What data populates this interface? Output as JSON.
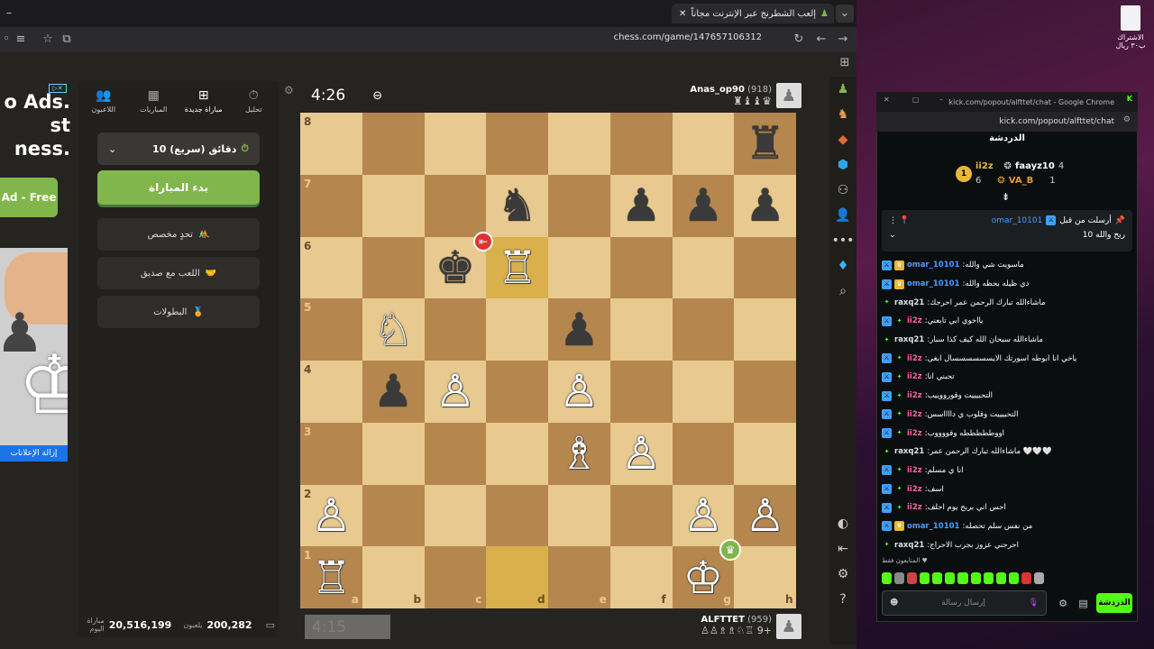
{
  "browser": {
    "tab_title": "إلعب الشطرنج عبر الإنترنت مجاناً",
    "url": "chess.com/game/147657106312"
  },
  "ad": {
    "headline": "o Ads.\nst\nness.",
    "button": "Ad - Free",
    "footer": "إزالة الإعلانات"
  },
  "panel": {
    "tabs": [
      {
        "label": "تحليل",
        "icon": "stopwatch-icon"
      },
      {
        "label": "مباراة جديدة",
        "icon": "plus-icon"
      },
      {
        "label": "المباريات",
        "icon": "board-icon"
      },
      {
        "label": "اللاعبون",
        "icon": "players-icon"
      }
    ],
    "time_control": "10 دقائق (سريع)",
    "start_button": "بدء المباراة",
    "buttons": [
      {
        "label": "تحدٍ مخصص"
      },
      {
        "label": "اللعب مع صديق"
      },
      {
        "label": "البطولات"
      }
    ],
    "stats": {
      "playing_value": "200,282",
      "playing_label": "يلعبون",
      "games_value": "20,516,199",
      "games_label": "مباراة اليوم"
    }
  },
  "game": {
    "top_clock": "4:26",
    "bottom_clock": "4:15",
    "top_player": {
      "name": "Anas_op90",
      "rating": "(918)",
      "captured": "♛♝♝♜"
    },
    "bottom_player": {
      "name": "ALFTTET",
      "rating": "(959)",
      "captured": "+9 ♖♘♗♗♙♙"
    },
    "files": [
      "a",
      "b",
      "c",
      "d",
      "e",
      "f",
      "g",
      "h"
    ],
    "ranks": [
      "8",
      "7",
      "6",
      "5",
      "4",
      "3",
      "2",
      "1"
    ],
    "pieces": [
      {
        "sq": "h8",
        "p": "♜",
        "c": "b"
      },
      {
        "sq": "d7",
        "p": "♞",
        "c": "b"
      },
      {
        "sq": "f7",
        "p": "♟",
        "c": "b"
      },
      {
        "sq": "g7",
        "p": "♟",
        "c": "b"
      },
      {
        "sq": "h7",
        "p": "♟",
        "c": "b"
      },
      {
        "sq": "c6",
        "p": "♚",
        "c": "b"
      },
      {
        "sq": "d6",
        "p": "♖",
        "c": "w"
      },
      {
        "sq": "b5",
        "p": "♘",
        "c": "w"
      },
      {
        "sq": "e5",
        "p": "♟",
        "c": "b"
      },
      {
        "sq": "b4",
        "p": "♟",
        "c": "b"
      },
      {
        "sq": "c4",
        "p": "♙",
        "c": "w"
      },
      {
        "sq": "e4",
        "p": "♙",
        "c": "w"
      },
      {
        "sq": "e3",
        "p": "♗",
        "c": "w"
      },
      {
        "sq": "f3",
        "p": "♙",
        "c": "w"
      },
      {
        "sq": "a2",
        "p": "♙",
        "c": "w"
      },
      {
        "sq": "g2",
        "p": "♙",
        "c": "w"
      },
      {
        "sq": "h2",
        "p": "♙",
        "c": "w"
      },
      {
        "sq": "a1",
        "p": "♖",
        "c": "w"
      },
      {
        "sq": "g1",
        "p": "♔",
        "c": "w"
      }
    ],
    "highlights": [
      "d6",
      "d1"
    ]
  },
  "desktop": {
    "icon_label": "الاشتراك ب٣٠ ريال"
  },
  "chat": {
    "window_title": "kick.com/popout/alfttet/chat - Google Chrome",
    "url": "kick.com/popout/alfttet/chat",
    "header": "الدردشة",
    "leaders": [
      {
        "rank": "1",
        "name": "ii2z",
        "count": "6"
      },
      {
        "rank": "",
        "name": "faayz10",
        "count": "4"
      },
      {
        "rank": "",
        "name": "VA_B",
        "count": "1"
      }
    ],
    "pinned_by": "أرسلت من قبل",
    "pinned_user": "omar_10101",
    "pinned_text": "ربح والله 10",
    "messages": [
      {
        "user": "omar_10101",
        "color": "#4b9cff",
        "text": ":ماسويت شي والله"
      },
      {
        "user": "omar_10101",
        "color": "#4b9cff",
        "text": ":ذي ظيله بحظه والله"
      },
      {
        "user": "raxq21",
        "color": "#e0e0e0",
        "text": ":ماشاءالله تبارك الرحمن عمر احرجك"
      },
      {
        "user": "ii2z",
        "color": "#ff5fa2",
        "text": ":يااخوي ابي تابعني"
      },
      {
        "user": "raxq21",
        "color": "#e0e0e0",
        "text": ":ماشاءالله سبحان الله كيف كذا سبار"
      },
      {
        "user": "ii2z",
        "color": "#ff5fa2",
        "text": ":ياخي انا ابوطه اسورتك الايسسسسسسال ابغى"
      },
      {
        "user": "ii2z",
        "color": "#ff5fa2",
        "text": ":تحبني انا"
      },
      {
        "user": "ii2z",
        "color": "#ff5fa2",
        "text": ":التحبيييت وقورووييب"
      },
      {
        "user": "ii2z",
        "color": "#ff5fa2",
        "text": ":التحبيييت وقلوب ي دااااسس"
      },
      {
        "user": "ii2z",
        "color": "#ff5fa2",
        "text": ":اووطططططه وقووووب"
      },
      {
        "user": "raxq21",
        "color": "#e0e0e0",
        "text": ":ماشاءالله تبارك الرحمن عمر 🤍🤍🤍"
      },
      {
        "user": "ii2z",
        "color": "#ff5fa2",
        "text": ":انا ي مسلم"
      },
      {
        "user": "ii2z",
        "color": "#ff5fa2",
        "text": ":اسف"
      },
      {
        "user": "ii2z",
        "color": "#ff5fa2",
        "text": ":احس اني بربح يوم احلف"
      },
      {
        "user": "omar_10101",
        "color": "#4b9cff",
        "text": ":من نفس سلم تحصله"
      },
      {
        "user": "raxq21",
        "color": "#e0e0e0",
        "text": ":احرجني عزوز بجرب الاحراج"
      }
    ],
    "typing": "المتابعون فقط",
    "input_placeholder": "إرسال رسالة",
    "send": "الدردشة"
  },
  "colors": {
    "accent": "#81b64c",
    "kick_green": "#53fc18",
    "light_square": "#e8c98f",
    "dark_square": "#b5874f"
  }
}
